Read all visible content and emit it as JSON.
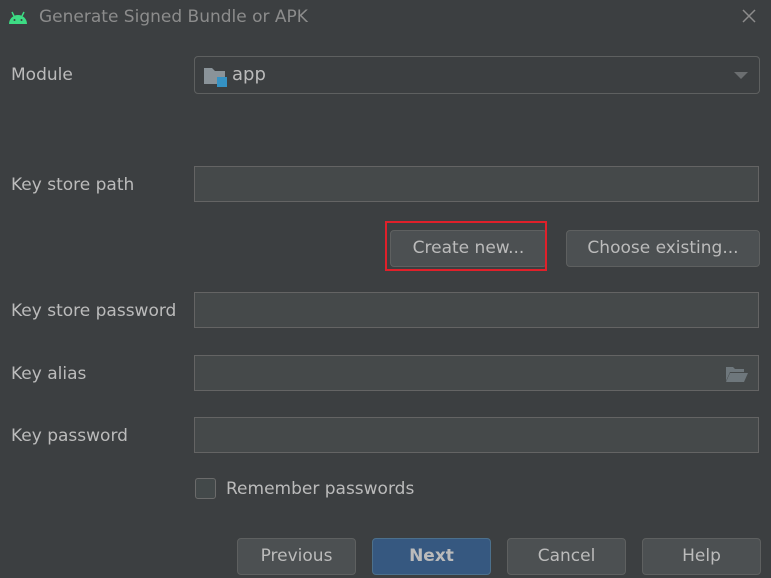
{
  "window": {
    "title": "Generate Signed Bundle or APK",
    "app_icon": "android-icon",
    "close_icon": "close-icon"
  },
  "colors": {
    "background": "#3c3f41",
    "field_background": "#45494a",
    "primary_button": "#365880",
    "highlight_border": "#e0202a",
    "android_green": "#3ddc84"
  },
  "form": {
    "module": {
      "label": "Module",
      "value": "app",
      "icon": "module-folder-icon"
    },
    "key_store_path": {
      "label": "Key store path",
      "value": ""
    },
    "create_new_label": "Create new...",
    "choose_existing_label": "Choose existing...",
    "key_store_password": {
      "label": "Key store password",
      "value": ""
    },
    "key_alias": {
      "label": "Key alias",
      "value": "",
      "browse_icon": "folder-open-icon"
    },
    "key_password": {
      "label": "Key password",
      "value": ""
    },
    "remember_passwords": {
      "label": "Remember passwords",
      "checked": false
    }
  },
  "buttons": {
    "previous": "Previous",
    "next": "Next",
    "cancel": "Cancel",
    "help": "Help"
  }
}
